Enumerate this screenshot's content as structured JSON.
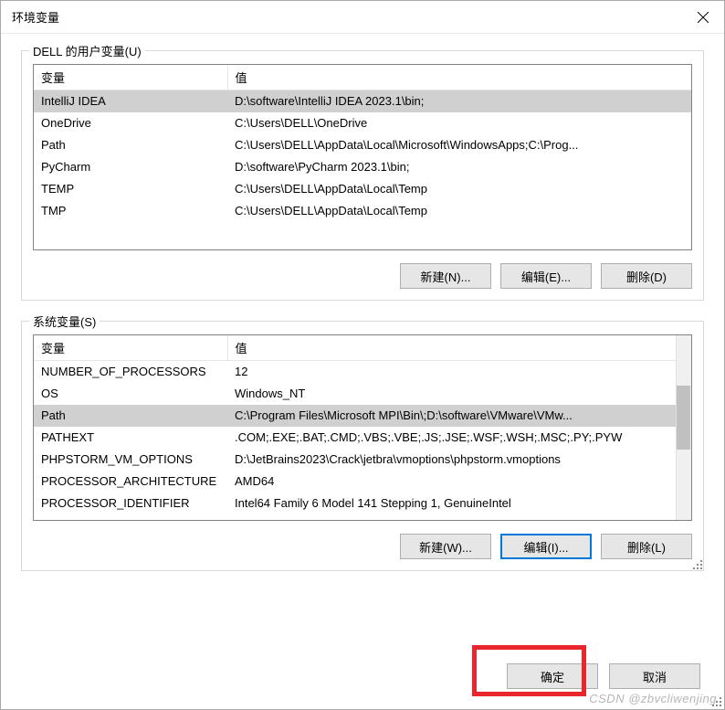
{
  "title": "环境变量",
  "userSection": {
    "legend": "DELL 的用户变量(U)",
    "headers": {
      "var": "变量",
      "val": "值"
    },
    "rows": [
      {
        "var": "IntelliJ IDEA",
        "val": "D:\\software\\IntelliJ IDEA 2023.1\\bin;",
        "selected": true
      },
      {
        "var": "OneDrive",
        "val": "C:\\Users\\DELL\\OneDrive"
      },
      {
        "var": "Path",
        "val": "C:\\Users\\DELL\\AppData\\Local\\Microsoft\\WindowsApps;C:\\Prog..."
      },
      {
        "var": "PyCharm",
        "val": "D:\\software\\PyCharm 2023.1\\bin;"
      },
      {
        "var": "TEMP",
        "val": "C:\\Users\\DELL\\AppData\\Local\\Temp"
      },
      {
        "var": "TMP",
        "val": "C:\\Users\\DELL\\AppData\\Local\\Temp"
      }
    ],
    "buttons": {
      "new": "新建(N)...",
      "edit": "编辑(E)...",
      "del": "删除(D)"
    }
  },
  "systemSection": {
    "legend": "系统变量(S)",
    "headers": {
      "var": "变量",
      "val": "值"
    },
    "rows": [
      {
        "var": "NUMBER_OF_PROCESSORS",
        "val": "12"
      },
      {
        "var": "OS",
        "val": "Windows_NT"
      },
      {
        "var": "Path",
        "val": "C:\\Program Files\\Microsoft MPI\\Bin\\;D:\\software\\VMware\\VMw...",
        "selected": true
      },
      {
        "var": "PATHEXT",
        "val": ".COM;.EXE;.BAT;.CMD;.VBS;.VBE;.JS;.JSE;.WSF;.WSH;.MSC;.PY;.PYW"
      },
      {
        "var": "PHPSTORM_VM_OPTIONS",
        "val": "D:\\JetBrains2023\\Crack\\jetbra\\vmoptions\\phpstorm.vmoptions"
      },
      {
        "var": "PROCESSOR_ARCHITECTURE",
        "val": "AMD64"
      },
      {
        "var": "PROCESSOR_IDENTIFIER",
        "val": "Intel64 Family 6 Model 141 Stepping 1, GenuineIntel"
      }
    ],
    "buttons": {
      "new": "新建(W)...",
      "edit": "编辑(I)...",
      "del": "删除(L)"
    }
  },
  "dialogButtons": {
    "ok": "确定",
    "cancel": "取消"
  },
  "watermark": "CSDN @zbvcliwenjing"
}
